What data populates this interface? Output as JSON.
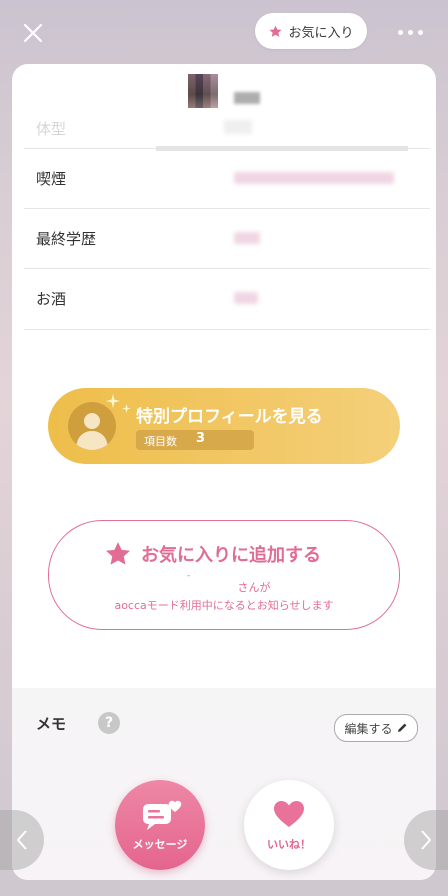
{
  "header": {
    "favorite_pill_label": "お気に入り"
  },
  "profile": {
    "faded_row_label": "体型"
  },
  "info_rows": [
    {
      "label": "喫煙"
    },
    {
      "label": "最終学歴"
    },
    {
      "label": "お酒"
    }
  ],
  "special_profile": {
    "title": "特別プロフィールを見る",
    "count_label": "項目数",
    "count_value": "3"
  },
  "favorite_add": {
    "title": "お気に入りに追加する",
    "dash": "-",
    "line1": "さんが",
    "line2": "aoccaモード利用中になるとお知らせします"
  },
  "memo": {
    "title": "メモ",
    "help_glyph": "?",
    "edit_label": "編集する"
  },
  "actions": {
    "message_label": "メッセージ",
    "like_label": "いいね！"
  },
  "colors": {
    "pink": "#e26d94",
    "gold": "#f0c35a"
  }
}
